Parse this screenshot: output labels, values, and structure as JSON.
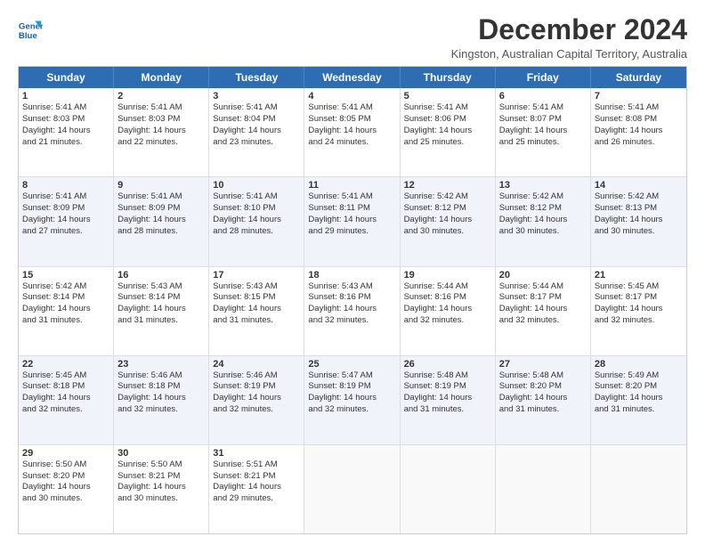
{
  "logo": {
    "line1": "General",
    "line2": "Blue"
  },
  "title": "December 2024",
  "subtitle": "Kingston, Australian Capital Territory, Australia",
  "header_days": [
    "Sunday",
    "Monday",
    "Tuesday",
    "Wednesday",
    "Thursday",
    "Friday",
    "Saturday"
  ],
  "rows": [
    [
      {
        "day": "1",
        "lines": [
          "Sunrise: 5:41 AM",
          "Sunset: 8:03 PM",
          "Daylight: 14 hours",
          "and 21 minutes."
        ]
      },
      {
        "day": "2",
        "lines": [
          "Sunrise: 5:41 AM",
          "Sunset: 8:03 PM",
          "Daylight: 14 hours",
          "and 22 minutes."
        ]
      },
      {
        "day": "3",
        "lines": [
          "Sunrise: 5:41 AM",
          "Sunset: 8:04 PM",
          "Daylight: 14 hours",
          "and 23 minutes."
        ]
      },
      {
        "day": "4",
        "lines": [
          "Sunrise: 5:41 AM",
          "Sunset: 8:05 PM",
          "Daylight: 14 hours",
          "and 24 minutes."
        ]
      },
      {
        "day": "5",
        "lines": [
          "Sunrise: 5:41 AM",
          "Sunset: 8:06 PM",
          "Daylight: 14 hours",
          "and 25 minutes."
        ]
      },
      {
        "day": "6",
        "lines": [
          "Sunrise: 5:41 AM",
          "Sunset: 8:07 PM",
          "Daylight: 14 hours",
          "and 25 minutes."
        ]
      },
      {
        "day": "7",
        "lines": [
          "Sunrise: 5:41 AM",
          "Sunset: 8:08 PM",
          "Daylight: 14 hours",
          "and 26 minutes."
        ]
      }
    ],
    [
      {
        "day": "8",
        "lines": [
          "Sunrise: 5:41 AM",
          "Sunset: 8:09 PM",
          "Daylight: 14 hours",
          "and 27 minutes."
        ]
      },
      {
        "day": "9",
        "lines": [
          "Sunrise: 5:41 AM",
          "Sunset: 8:09 PM",
          "Daylight: 14 hours",
          "and 28 minutes."
        ]
      },
      {
        "day": "10",
        "lines": [
          "Sunrise: 5:41 AM",
          "Sunset: 8:10 PM",
          "Daylight: 14 hours",
          "and 28 minutes."
        ]
      },
      {
        "day": "11",
        "lines": [
          "Sunrise: 5:41 AM",
          "Sunset: 8:11 PM",
          "Daylight: 14 hours",
          "and 29 minutes."
        ]
      },
      {
        "day": "12",
        "lines": [
          "Sunrise: 5:42 AM",
          "Sunset: 8:12 PM",
          "Daylight: 14 hours",
          "and 30 minutes."
        ]
      },
      {
        "day": "13",
        "lines": [
          "Sunrise: 5:42 AM",
          "Sunset: 8:12 PM",
          "Daylight: 14 hours",
          "and 30 minutes."
        ]
      },
      {
        "day": "14",
        "lines": [
          "Sunrise: 5:42 AM",
          "Sunset: 8:13 PM",
          "Daylight: 14 hours",
          "and 30 minutes."
        ]
      }
    ],
    [
      {
        "day": "15",
        "lines": [
          "Sunrise: 5:42 AM",
          "Sunset: 8:14 PM",
          "Daylight: 14 hours",
          "and 31 minutes."
        ]
      },
      {
        "day": "16",
        "lines": [
          "Sunrise: 5:43 AM",
          "Sunset: 8:14 PM",
          "Daylight: 14 hours",
          "and 31 minutes."
        ]
      },
      {
        "day": "17",
        "lines": [
          "Sunrise: 5:43 AM",
          "Sunset: 8:15 PM",
          "Daylight: 14 hours",
          "and 31 minutes."
        ]
      },
      {
        "day": "18",
        "lines": [
          "Sunrise: 5:43 AM",
          "Sunset: 8:16 PM",
          "Daylight: 14 hours",
          "and 32 minutes."
        ]
      },
      {
        "day": "19",
        "lines": [
          "Sunrise: 5:44 AM",
          "Sunset: 8:16 PM",
          "Daylight: 14 hours",
          "and 32 minutes."
        ]
      },
      {
        "day": "20",
        "lines": [
          "Sunrise: 5:44 AM",
          "Sunset: 8:17 PM",
          "Daylight: 14 hours",
          "and 32 minutes."
        ]
      },
      {
        "day": "21",
        "lines": [
          "Sunrise: 5:45 AM",
          "Sunset: 8:17 PM",
          "Daylight: 14 hours",
          "and 32 minutes."
        ]
      }
    ],
    [
      {
        "day": "22",
        "lines": [
          "Sunrise: 5:45 AM",
          "Sunset: 8:18 PM",
          "Daylight: 14 hours",
          "and 32 minutes."
        ]
      },
      {
        "day": "23",
        "lines": [
          "Sunrise: 5:46 AM",
          "Sunset: 8:18 PM",
          "Daylight: 14 hours",
          "and 32 minutes."
        ]
      },
      {
        "day": "24",
        "lines": [
          "Sunrise: 5:46 AM",
          "Sunset: 8:19 PM",
          "Daylight: 14 hours",
          "and 32 minutes."
        ]
      },
      {
        "day": "25",
        "lines": [
          "Sunrise: 5:47 AM",
          "Sunset: 8:19 PM",
          "Daylight: 14 hours",
          "and 32 minutes."
        ]
      },
      {
        "day": "26",
        "lines": [
          "Sunrise: 5:48 AM",
          "Sunset: 8:19 PM",
          "Daylight: 14 hours",
          "and 31 minutes."
        ]
      },
      {
        "day": "27",
        "lines": [
          "Sunrise: 5:48 AM",
          "Sunset: 8:20 PM",
          "Daylight: 14 hours",
          "and 31 minutes."
        ]
      },
      {
        "day": "28",
        "lines": [
          "Sunrise: 5:49 AM",
          "Sunset: 8:20 PM",
          "Daylight: 14 hours",
          "and 31 minutes."
        ]
      }
    ],
    [
      {
        "day": "29",
        "lines": [
          "Sunrise: 5:50 AM",
          "Sunset: 8:20 PM",
          "Daylight: 14 hours",
          "and 30 minutes."
        ]
      },
      {
        "day": "30",
        "lines": [
          "Sunrise: 5:50 AM",
          "Sunset: 8:21 PM",
          "Daylight: 14 hours",
          "and 30 minutes."
        ]
      },
      {
        "day": "31",
        "lines": [
          "Sunrise: 5:51 AM",
          "Sunset: 8:21 PM",
          "Daylight: 14 hours",
          "and 29 minutes."
        ]
      },
      {
        "day": "",
        "lines": []
      },
      {
        "day": "",
        "lines": []
      },
      {
        "day": "",
        "lines": []
      },
      {
        "day": "",
        "lines": []
      }
    ]
  ]
}
